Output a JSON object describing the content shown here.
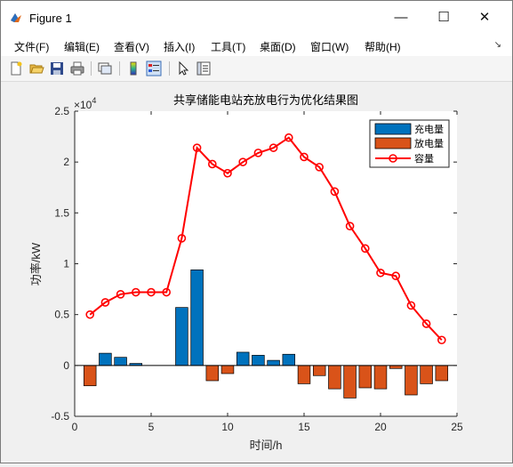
{
  "window": {
    "title": "Figure 1",
    "minimize_glyph": "—",
    "maximize_glyph": "☐",
    "close_glyph": "✕"
  },
  "menu": [
    {
      "label": "文件(F)"
    },
    {
      "label": "编辑(E)"
    },
    {
      "label": "查看(V)"
    },
    {
      "label": "插入(I)"
    },
    {
      "label": "工具(T)"
    },
    {
      "label": "桌面(D)"
    },
    {
      "label": "窗口(W)"
    },
    {
      "label": "帮助(H)"
    }
  ],
  "toolbar_icons": [
    "new-file-icon",
    "open-folder-icon",
    "save-icon",
    "print-icon",
    "link-plot-icon",
    "insert-colorbar-icon",
    "insert-legend-icon",
    "pointer-icon",
    "property-inspector-icon"
  ],
  "colors": {
    "charge": "#0072bd",
    "discharge": "#d95319",
    "capacity": "#ff0000"
  },
  "chart_data": {
    "type": "bar",
    "title": "共享储能电站充放电行为优化结果图",
    "xlabel": "时间/h",
    "ylabel": "功率/kW",
    "y_exponent_label": "×10",
    "y_exponent_power": "4",
    "xlim": [
      0,
      25
    ],
    "ylim": [
      -5000,
      25000
    ],
    "xticks": [
      0,
      5,
      10,
      15,
      20,
      25
    ],
    "xtick_labels": [
      "0",
      "5",
      "10",
      "15",
      "20",
      "25"
    ],
    "yticks": [
      -5000,
      0,
      5000,
      10000,
      15000,
      20000,
      25000
    ],
    "ytick_labels": [
      "-0.5",
      "0",
      "0.5",
      "1",
      "1.5",
      "2",
      "2.5"
    ],
    "grid": false,
    "legend_position": "top-right",
    "x": [
      1,
      2,
      3,
      4,
      5,
      6,
      7,
      8,
      9,
      10,
      11,
      12,
      13,
      14,
      15,
      16,
      17,
      18,
      19,
      20,
      21,
      22,
      23,
      24
    ],
    "series": [
      {
        "name": "充电量",
        "kind": "bar",
        "values": [
          0,
          1200,
          800,
          200,
          0,
          0,
          5700,
          9400,
          0,
          0,
          1300,
          1000,
          500,
          1100,
          0,
          0,
          0,
          0,
          0,
          0,
          0,
          0,
          0,
          0
        ]
      },
      {
        "name": "放电量",
        "kind": "bar",
        "values": [
          -2000,
          0,
          0,
          0,
          0,
          0,
          0,
          0,
          -1500,
          -800,
          0,
          0,
          0,
          0,
          -1800,
          -1000,
          -2300,
          -3200,
          -2200,
          -2300,
          -300,
          -2900,
          -1800,
          -1500
        ]
      },
      {
        "name": "容量",
        "kind": "line",
        "marker": "circle",
        "values": [
          5000,
          6200,
          7000,
          7200,
          7200,
          7200,
          12500,
          21400,
          19800,
          18900,
          20000,
          20900,
          21400,
          22400,
          20500,
          19500,
          17100,
          13700,
          11500,
          9100,
          8800,
          5900,
          4100,
          2500
        ]
      }
    ]
  }
}
